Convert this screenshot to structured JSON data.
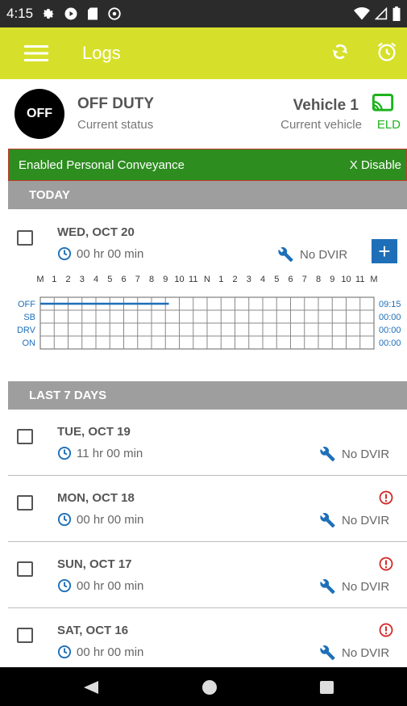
{
  "statusbar": {
    "time": "4:15"
  },
  "appbar": {
    "title": "Logs"
  },
  "status": {
    "off_badge": "OFF",
    "title": "OFF DUTY",
    "subtitle": "Current status",
    "vehicle_title": "Vehicle 1",
    "vehicle_subtitle": "Current vehicle",
    "eld_label": "ELD"
  },
  "conveyance": {
    "text": "Enabled Personal Conveyance",
    "disable_label": "X Disable"
  },
  "sections": {
    "today": "TODAY",
    "last7": "LAST 7 DAYS"
  },
  "today": {
    "date": "WED, OCT 20",
    "duration": "00 hr  00 min",
    "dvir": "No DVIR",
    "add_label": "+"
  },
  "graph": {
    "hour_labels": [
      "M",
      "1",
      "2",
      "3",
      "4",
      "5",
      "6",
      "7",
      "8",
      "9",
      "10",
      "11",
      "N",
      "1",
      "2",
      "3",
      "4",
      "5",
      "6",
      "7",
      "8",
      "9",
      "10",
      "11",
      "M"
    ],
    "rows": [
      {
        "label": "OFF",
        "total": "09:15"
      },
      {
        "label": "SB",
        "total": "00:00"
      },
      {
        "label": "DRV",
        "total": "00:00"
      },
      {
        "label": "ON",
        "total": "00:00"
      }
    ],
    "off_duty_until_hour": 9.25,
    "line_color": "#1e6fb8"
  },
  "days": [
    {
      "date": "TUE, OCT 19",
      "duration": "11 hr  00 min",
      "dvir": "No DVIR",
      "alert": false
    },
    {
      "date": "MON, OCT 18",
      "duration": "00 hr  00 min",
      "dvir": "No DVIR",
      "alert": true
    },
    {
      "date": "SUN, OCT 17",
      "duration": "00 hr  00 min",
      "dvir": "No DVIR",
      "alert": true
    },
    {
      "date": "SAT, OCT 16",
      "duration": "00 hr  00 min",
      "dvir": "No DVIR",
      "alert": true
    }
  ],
  "colors": {
    "appbar": "#d6e02a",
    "conveyance": "#2d8d1f",
    "accent": "#1e6fb8",
    "alert": "#d32f2f",
    "eld": "#1db31d"
  }
}
